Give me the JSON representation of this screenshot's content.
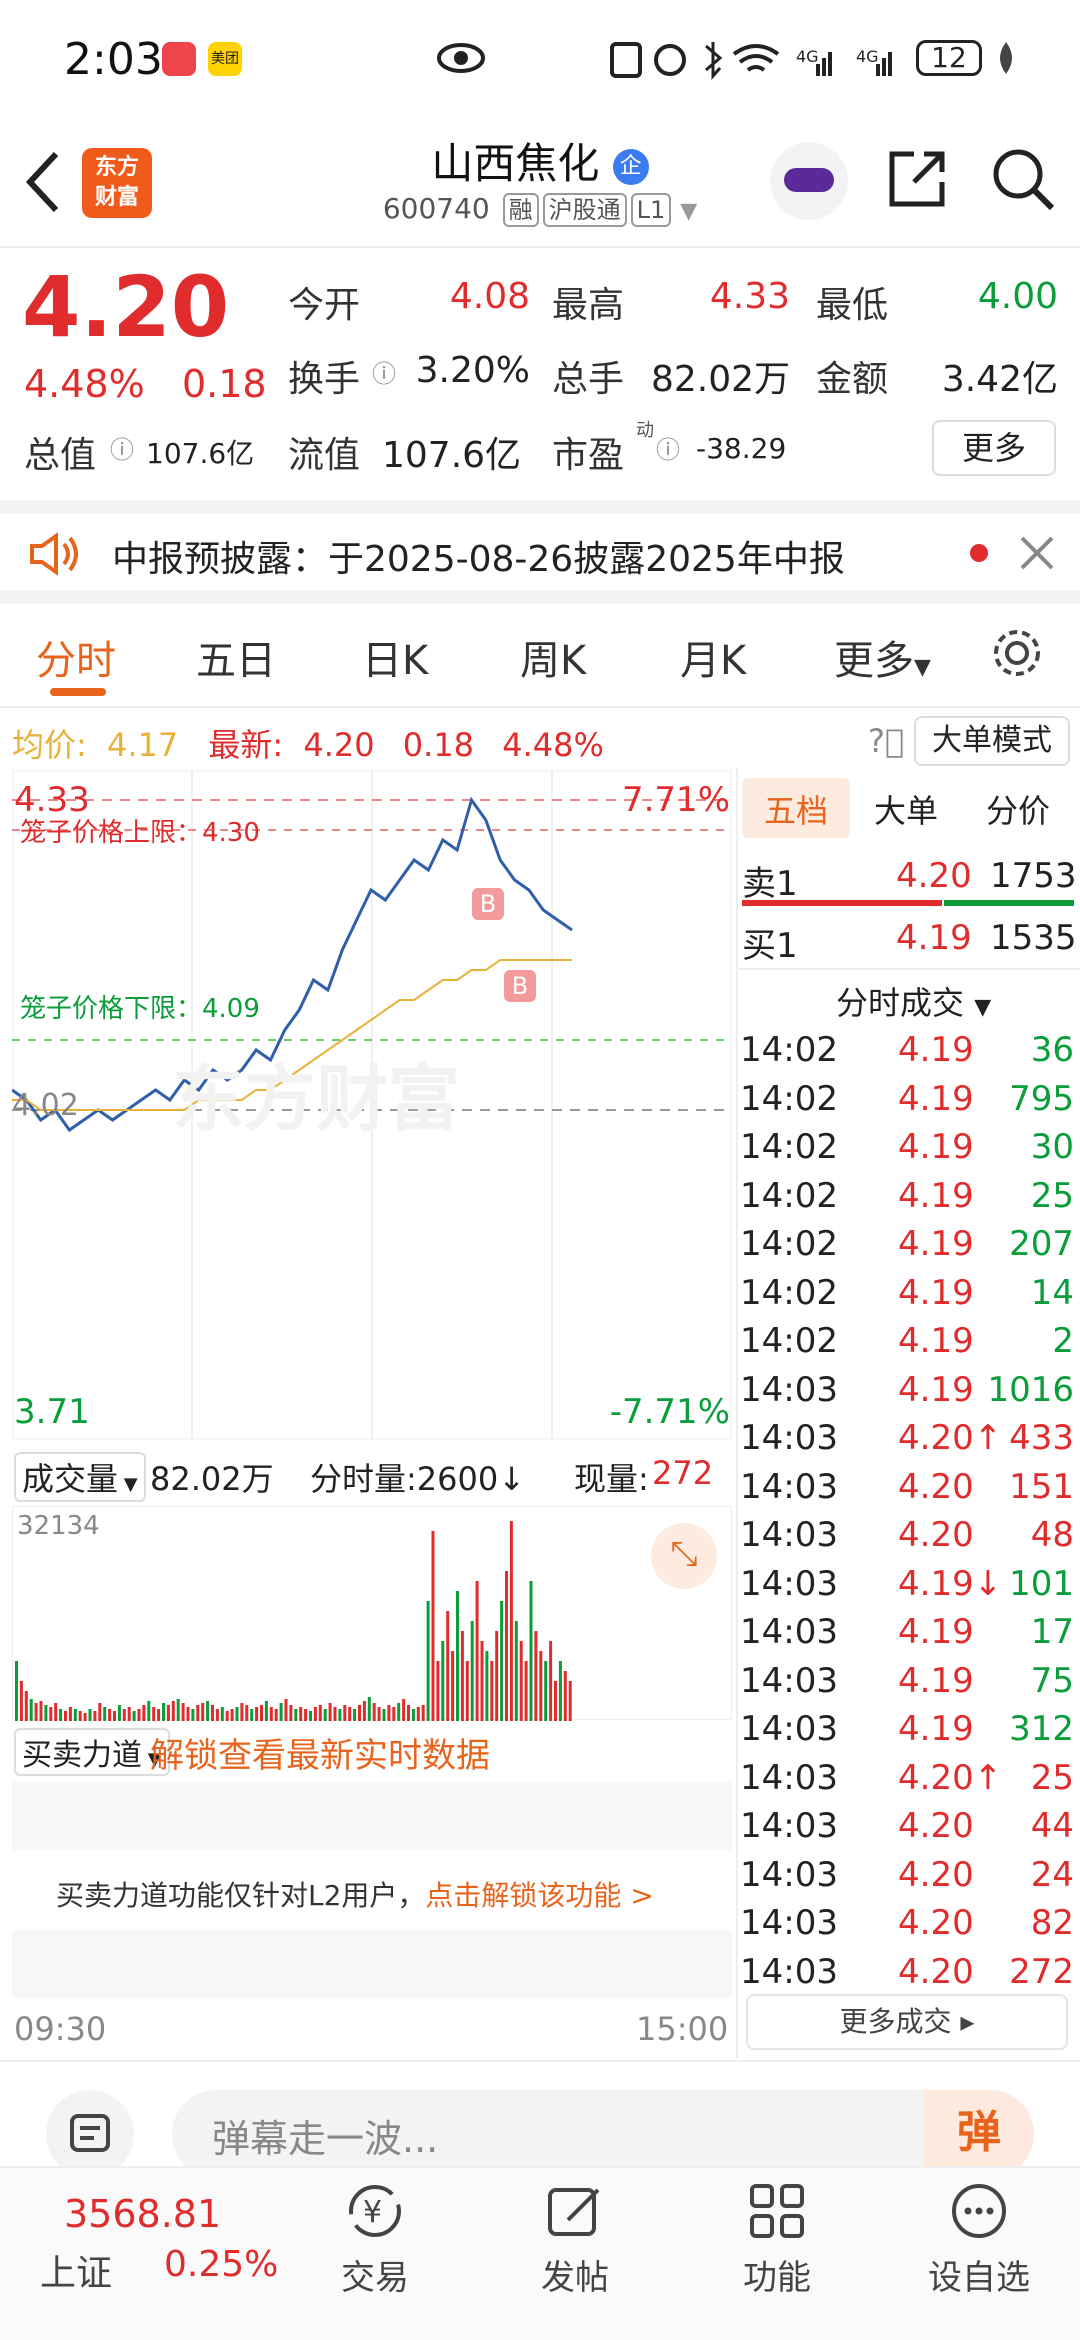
{
  "status_bar": {
    "time": "2:03",
    "battery": "12",
    "icons": [
      "xiaohongshu-icon",
      "meituan-icon",
      "eye-icon",
      "nfc-icon",
      "alarm-icon",
      "bluetooth-icon",
      "wifi-icon",
      "signal-4g-icon",
      "battery-icon"
    ],
    "meituan_text": "美团"
  },
  "header": {
    "title": "山西焦化",
    "title_badge": "企",
    "code": "600740",
    "tags": [
      "融",
      "沪股通",
      "L1"
    ],
    "logo_text": "东方\n财富",
    "logo_line1": "东方",
    "logo_line2": "财富"
  },
  "quote": {
    "price": "4.20",
    "change_pct": "4.48%",
    "change": "0.18",
    "open_label": "今开",
    "open": "4.08",
    "high_label": "最高",
    "high": "4.33",
    "low_label": "最低",
    "low": "4.00",
    "turnover_label": "换手",
    "turnover": "3.20%",
    "volume_label": "总手",
    "volume": "82.02万",
    "amount_label": "金额",
    "amount": "3.42亿",
    "mcap_label": "总值",
    "mcap": "107.6亿",
    "float_label": "流值",
    "float": "107.6亿",
    "pe_label": "市盈",
    "pe_sup": "动",
    "pe": "-38.29",
    "more_button": "更多"
  },
  "notice": {
    "text": "中报预披露：于2025-08-26披露2025年中报"
  },
  "tabs": [
    "分时",
    "五日",
    "日K",
    "周K",
    "月K",
    "更多"
  ],
  "active_tab": "分时",
  "info_bar": {
    "avg_label": "均价:",
    "avg": "4.17",
    "latest_label": "最新:",
    "latest": "4.20",
    "chg": "0.18",
    "pct": "4.48%",
    "mode_button": "大单模式"
  },
  "chart": {
    "y_top": "4.33",
    "y_top_pct": "7.71%",
    "y_bottom": "3.71",
    "y_bottom_pct": "-7.71%",
    "y_mid": "4.02",
    "cage_upper": "笼子价格上限：4.30",
    "cage_lower": "笼子价格下限：4.09",
    "marker": "B",
    "watermark": "东方财富",
    "x_start": "09:30",
    "x_end": "15:00"
  },
  "chart_data": {
    "type": "line",
    "x_labels": [
      "09:30",
      "15:00"
    ],
    "ylim": [
      3.71,
      4.33
    ],
    "prev_close": 4.02,
    "series": [
      {
        "name": "最新",
        "values": [
          4.04,
          4.03,
          4.01,
          4.02,
          4.0,
          4.01,
          4.02,
          4.01,
          4.02,
          4.03,
          4.04,
          4.03,
          4.05,
          4.04,
          4.06,
          4.05,
          4.06,
          4.08,
          4.07,
          4.1,
          4.12,
          4.15,
          4.14,
          4.18,
          4.21,
          4.24,
          4.23,
          4.25,
          4.27,
          4.26,
          4.29,
          4.28,
          4.33,
          4.31,
          4.27,
          4.25,
          4.24,
          4.22,
          4.21,
          4.2
        ]
      },
      {
        "name": "均价",
        "values": [
          4.03,
          4.03,
          4.02,
          4.02,
          4.02,
          4.02,
          4.02,
          4.02,
          4.02,
          4.02,
          4.02,
          4.02,
          4.02,
          4.03,
          4.03,
          4.03,
          4.03,
          4.04,
          4.04,
          4.05,
          4.06,
          4.07,
          4.08,
          4.09,
          4.1,
          4.11,
          4.12,
          4.13,
          4.13,
          4.14,
          4.15,
          4.15,
          4.16,
          4.16,
          4.17,
          4.17,
          4.17,
          4.17,
          4.17,
          4.17
        ]
      }
    ]
  },
  "volume_bar": {
    "label": "成交量",
    "total": "82.02万",
    "fs_label": "分时量:2600↓",
    "now_label": "现量:",
    "now": "272",
    "max": "32134"
  },
  "power": {
    "label": "买卖力道",
    "unlock": "解锁查看最新实时数据",
    "lock_text": "买卖力道功能仅针对L2用户，",
    "lock_link": "点击解锁该功能 >"
  },
  "side_tabs": [
    "五档",
    "大单",
    "分价"
  ],
  "order_book": [
    {
      "side": "卖1",
      "price": "4.20",
      "vol": "1753"
    },
    {
      "side": "买1",
      "price": "4.19",
      "vol": "1535"
    }
  ],
  "trades_header": "分时成交",
  "trades": [
    {
      "t": "14:02",
      "p": "4.19",
      "v": "36",
      "c": "red",
      "vc": "green"
    },
    {
      "t": "14:02",
      "p": "4.19",
      "v": "795",
      "c": "red",
      "vc": "green"
    },
    {
      "t": "14:02",
      "p": "4.19",
      "v": "30",
      "c": "red",
      "vc": "green"
    },
    {
      "t": "14:02",
      "p": "4.19",
      "v": "25",
      "c": "red",
      "vc": "green"
    },
    {
      "t": "14:02",
      "p": "4.19",
      "v": "207",
      "c": "red",
      "vc": "green"
    },
    {
      "t": "14:02",
      "p": "4.19",
      "v": "14",
      "c": "red",
      "vc": "green"
    },
    {
      "t": "14:02",
      "p": "4.19",
      "v": "2",
      "c": "red",
      "vc": "green"
    },
    {
      "t": "14:03",
      "p": "4.19",
      "v": "1016",
      "c": "red",
      "vc": "green"
    },
    {
      "t": "14:03",
      "p": "4.20↑",
      "v": "433",
      "c": "red",
      "vc": "red"
    },
    {
      "t": "14:03",
      "p": "4.20",
      "v": "151",
      "c": "red",
      "vc": "red"
    },
    {
      "t": "14:03",
      "p": "4.20",
      "v": "48",
      "c": "red",
      "vc": "red"
    },
    {
      "t": "14:03",
      "p": "4.19↓",
      "v": "101",
      "c": "red",
      "vc": "green"
    },
    {
      "t": "14:03",
      "p": "4.19",
      "v": "17",
      "c": "red",
      "vc": "green"
    },
    {
      "t": "14:03",
      "p": "4.19",
      "v": "75",
      "c": "red",
      "vc": "green"
    },
    {
      "t": "14:03",
      "p": "4.19",
      "v": "312",
      "c": "red",
      "vc": "green"
    },
    {
      "t": "14:03",
      "p": "4.20↑",
      "v": "25",
      "c": "red",
      "vc": "red"
    },
    {
      "t": "14:03",
      "p": "4.20",
      "v": "44",
      "c": "red",
      "vc": "red"
    },
    {
      "t": "14:03",
      "p": "4.20",
      "v": "24",
      "c": "red",
      "vc": "red"
    },
    {
      "t": "14:03",
      "p": "4.20",
      "v": "82",
      "c": "red",
      "vc": "red"
    },
    {
      "t": "14:03",
      "p": "4.20",
      "v": "272",
      "c": "red",
      "vc": "red"
    }
  ],
  "more_trades": "更多成交",
  "danmu": {
    "placeholder": "弹幕走一波...",
    "button": "弹"
  },
  "bottom": {
    "index_value": "3568.81",
    "index_name": "上证",
    "index_pct": "0.25%",
    "nav": [
      "交易",
      "发帖",
      "功能",
      "设自选"
    ]
  },
  "colors": {
    "up": "#e02c2c",
    "down": "#0a9d3a",
    "accent": "#e8641c",
    "line": "#2f5fa8",
    "avg": "#e8b23a"
  }
}
